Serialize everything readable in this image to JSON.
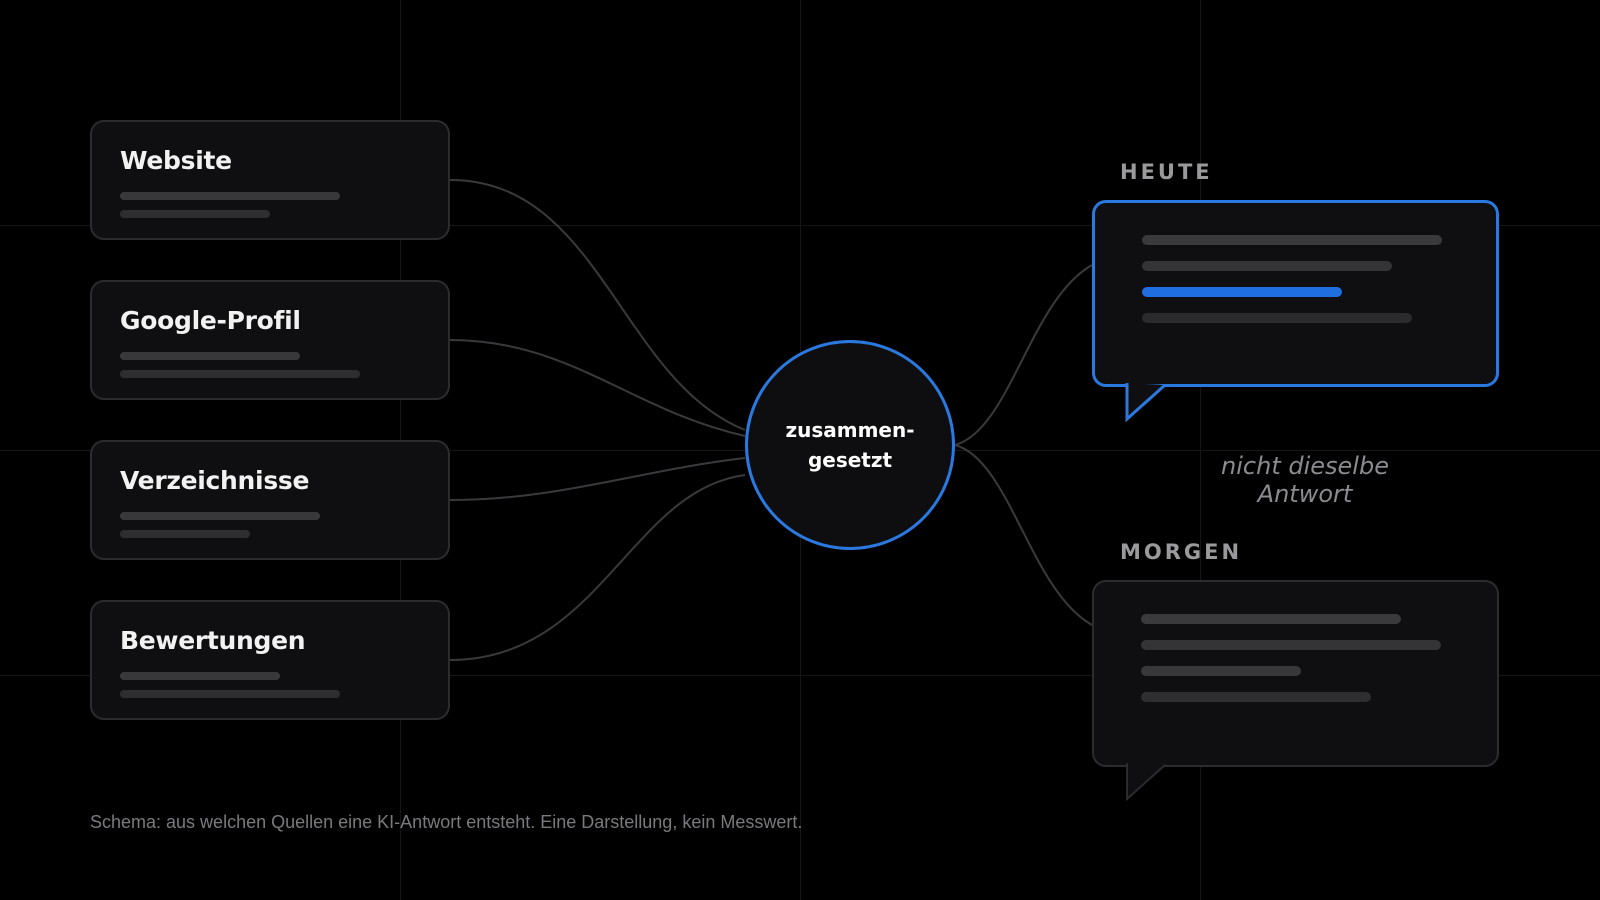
{
  "sources": [
    {
      "title": "Website"
    },
    {
      "title": "Google-Profil"
    },
    {
      "title": "Verzeichnisse"
    },
    {
      "title": "Bewertungen"
    }
  ],
  "hub": {
    "label": "zusammen-\ngesetzt"
  },
  "outputs": {
    "today_label": "HEUTE",
    "tomorrow_label": "MORGEN",
    "difference_caption": "nicht dieselbe Antwort"
  },
  "footnote": "Schema: aus welchen Quellen eine KI-Antwort entsteht. Eine Darstellung, kein Messwert.",
  "colors": {
    "background": "#000000",
    "accent": "#2a79e0",
    "card": "#0f0f11",
    "connector": "#3a3a3d"
  }
}
